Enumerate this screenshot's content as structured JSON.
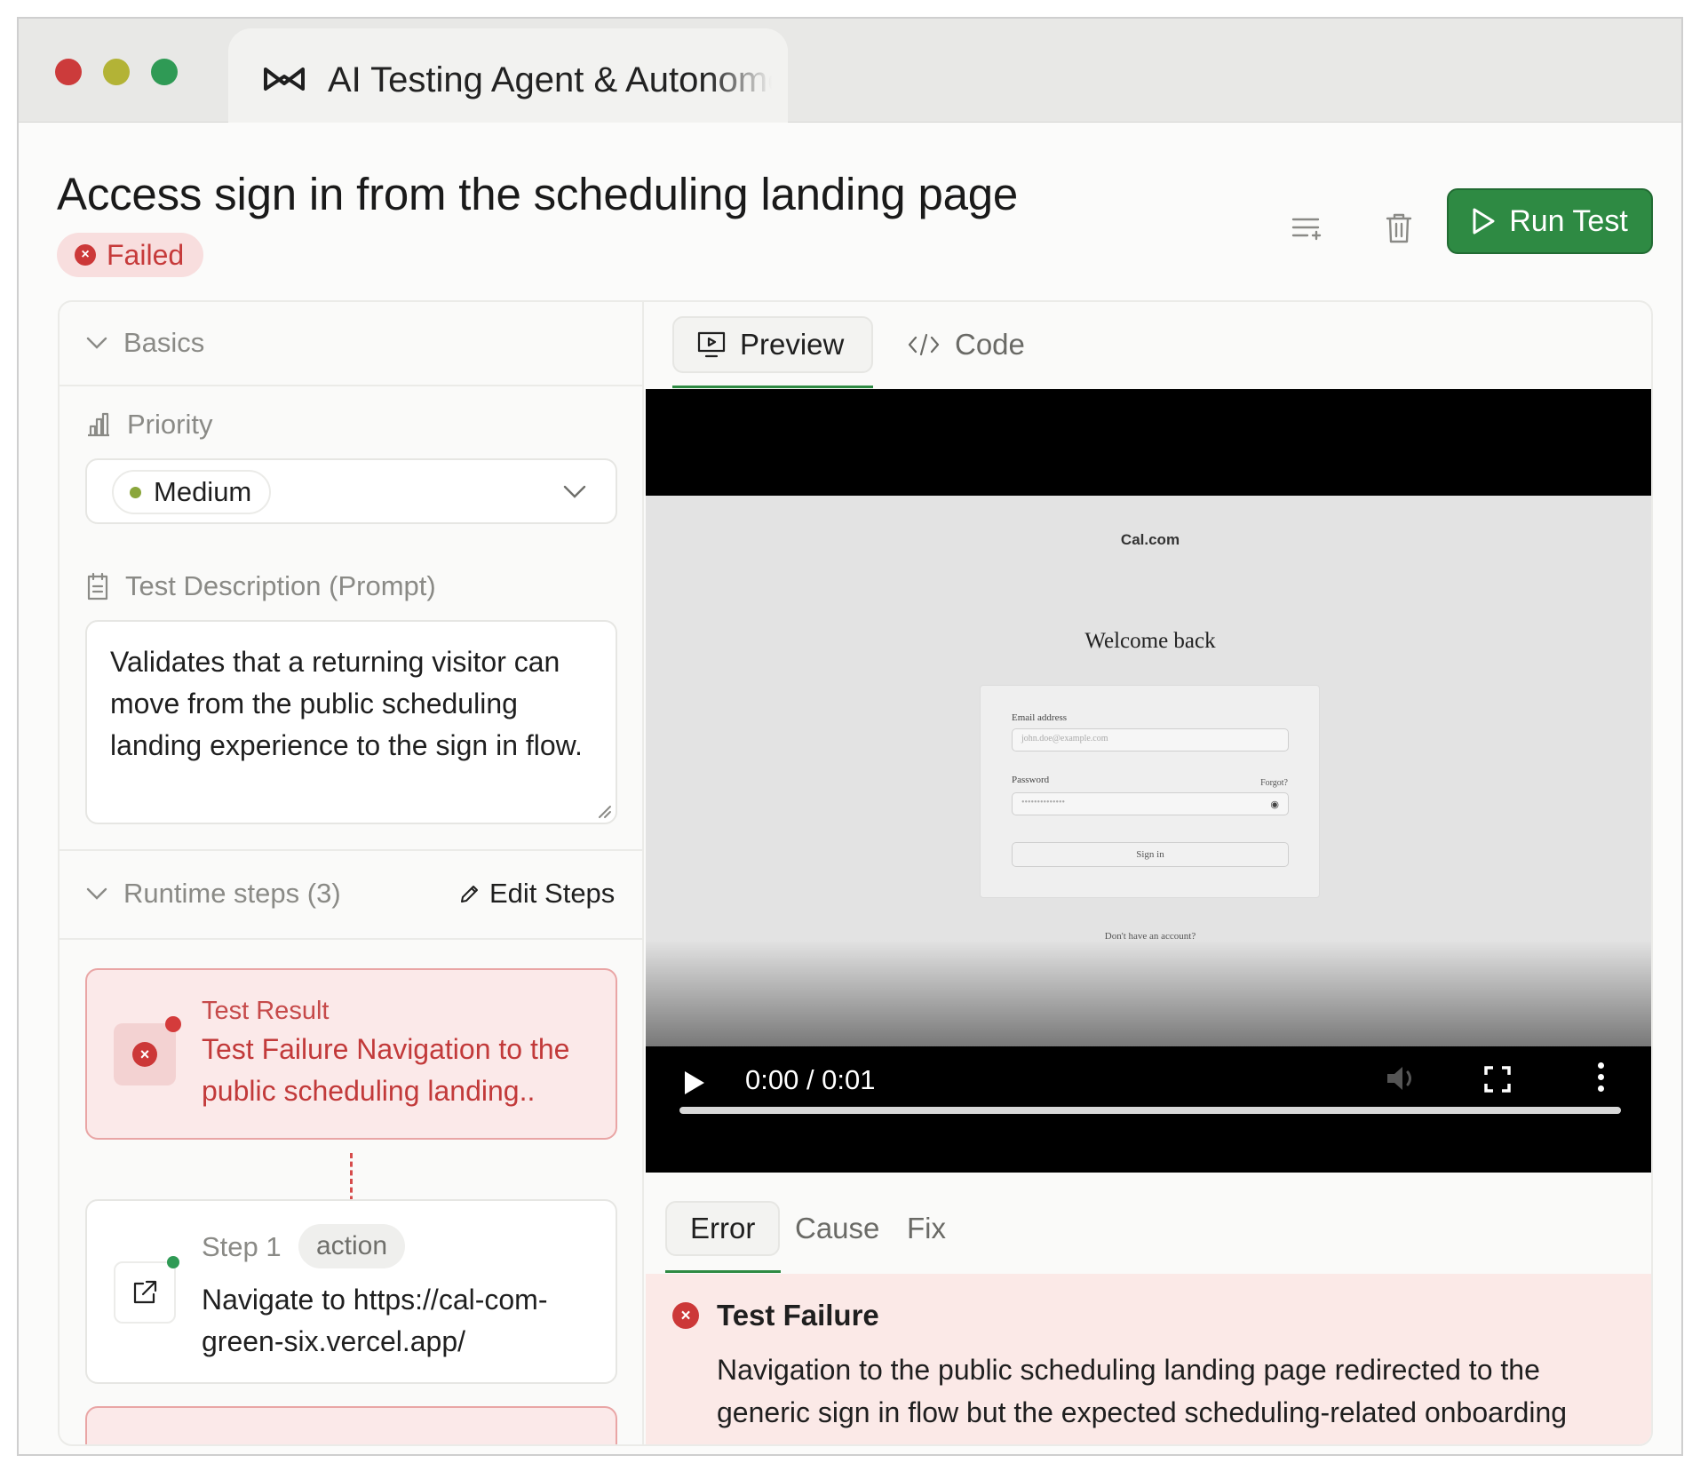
{
  "window": {
    "tab_title": "AI Testing Agent & Autonomous QA"
  },
  "header": {
    "title": "Access sign in from the scheduling landing page",
    "status": "Failed",
    "run_button": "Run Test"
  },
  "left_panel": {
    "basics_label": "Basics",
    "priority_label": "Priority",
    "priority_value": "Medium",
    "description_label": "Test Description (Prompt)",
    "description_text": "Validates that a returning visitor can move from the public scheduling landing experience to the sign in flow.",
    "runtime_label": "Runtime steps (3)",
    "edit_steps": "Edit Steps",
    "result": {
      "label": "Test Result",
      "text": "Test Failure Navigation to the public scheduling landing.."
    },
    "steps": [
      {
        "number": "Step 1",
        "type": "action",
        "text": "Navigate to https://cal-com-green-six.vercel.app/"
      }
    ]
  },
  "right_panel": {
    "tabs": [
      {
        "label": "Preview"
      },
      {
        "label": "Code"
      }
    ],
    "video": {
      "brand": "Cal.com",
      "heading": "Welcome back",
      "email_label": "Email address",
      "email_placeholder": "john.doe@example.com",
      "password_label": "Password",
      "forgot": "Forgot?",
      "password_mask": "••••••••••••••",
      "signin": "Sign in",
      "no_account": "Don't have an account?",
      "time": "0:00 / 0:01",
      "progress": 0.0
    },
    "detail_tabs": [
      {
        "label": "Error"
      },
      {
        "label": "Cause"
      },
      {
        "label": "Fix"
      }
    ],
    "error": {
      "title": "Test Failure",
      "text": "Navigation to the public scheduling landing page redirected to the generic sign in flow but the expected scheduling-related onboarding"
    }
  },
  "colors": {
    "accent": "#2e8a43",
    "failed": "#c63a3a",
    "failed_bg": "#fbe9e9",
    "priority_dot": "#8aa63b"
  }
}
